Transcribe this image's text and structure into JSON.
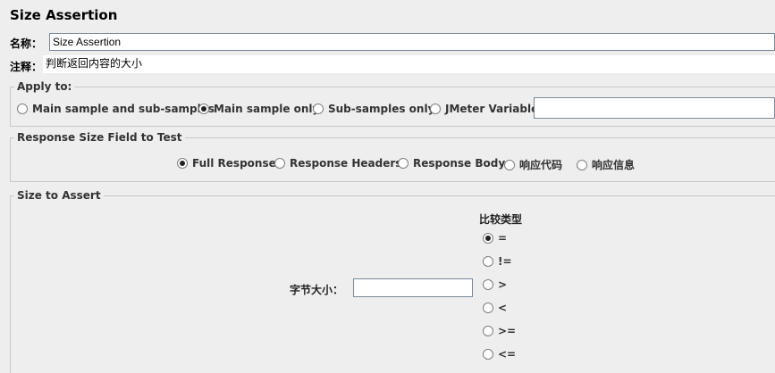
{
  "window": {
    "title": "Size Assertion"
  },
  "name_field": {
    "label": "名称：",
    "value": "Size Assertion"
  },
  "comment_field": {
    "label": "注释：",
    "value": "判断返回内容的大小"
  },
  "apply_to": {
    "title": "Apply to:",
    "options": [
      "Main sample and sub-samples",
      "Main sample only",
      "Sub-samples only",
      "JMeter Variable"
    ],
    "selected": "Main sample only",
    "variable_value": ""
  },
  "response_field": {
    "title": "Response Size Field to Test",
    "options": [
      "Full Response",
      "Response Headers",
      "Response Body",
      "响应代码",
      "响应信息"
    ],
    "selected": "Full Response"
  },
  "size_to_assert": {
    "title": "Size to Assert",
    "size_label": "字节大小：",
    "size_value": "",
    "compare_title": "比较类型",
    "operators": [
      "=",
      "!=",
      ">",
      "<",
      ">=",
      "<="
    ],
    "selected": "="
  }
}
